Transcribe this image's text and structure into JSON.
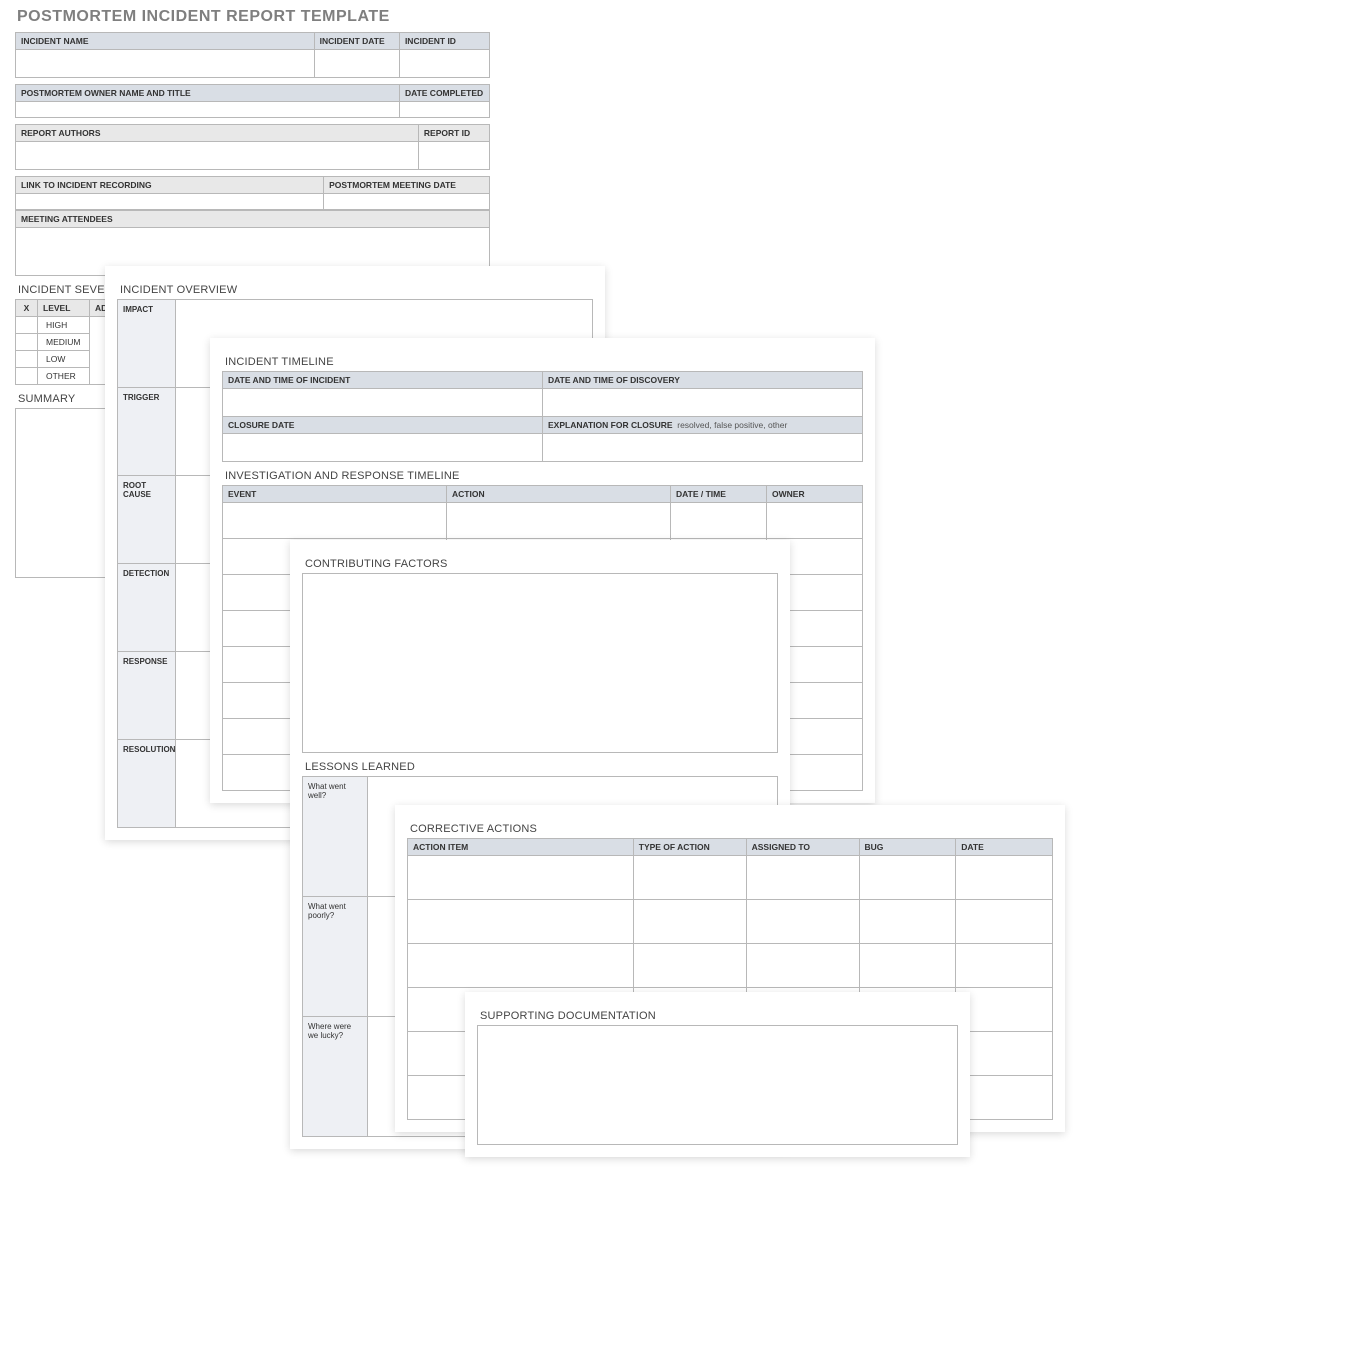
{
  "title": "POSTMORTEM INCIDENT REPORT TEMPLATE",
  "headers": {
    "incident_name": "INCIDENT NAME",
    "incident_date": "INCIDENT DATE",
    "incident_id": "INCIDENT ID",
    "owner": "POSTMORTEM OWNER NAME AND TITLE",
    "date_completed": "DATE COMPLETED",
    "report_authors": "REPORT AUTHORS",
    "report_id": "REPORT ID",
    "link_recording": "LINK TO INCIDENT RECORDING",
    "meeting_date": "POSTMORTEM MEETING DATE",
    "attendees": "MEETING ATTENDEES"
  },
  "severity": {
    "title": "INCIDENT SEVERITY",
    "x": "X",
    "level": "LEVEL",
    "add": "ADD",
    "levels": [
      "HIGH",
      "MEDIUM",
      "LOW",
      "OTHER"
    ]
  },
  "summary": "SUMMARY",
  "overview": {
    "title": "INCIDENT OVERVIEW",
    "rows": [
      "IMPACT",
      "TRIGGER",
      "ROOT CAUSE",
      "DETECTION",
      "RESPONSE",
      "RESOLUTION"
    ]
  },
  "timeline": {
    "title": "INCIDENT TIMELINE",
    "dt_incident": "DATE AND TIME OF INCIDENT",
    "dt_discovery": "DATE AND TIME OF DISCOVERY",
    "closure": "CLOSURE DATE",
    "closure_exp": "EXPLANATION FOR CLOSURE",
    "closure_hint": "resolved, false positive, other"
  },
  "investigation": {
    "title": "INVESTIGATION AND RESPONSE TIMELINE",
    "cols": [
      "EVENT",
      "ACTION",
      "DATE / TIME",
      "OWNER"
    ]
  },
  "contributing": "CONTRIBUTING FACTORS",
  "lessons": {
    "title": "LESSONS LEARNED",
    "rows": [
      "What went well?",
      "What went poorly?",
      "Where were we lucky?"
    ]
  },
  "corrective": {
    "title": "CORRECTIVE ACTIONS",
    "cols": [
      "ACTION ITEM",
      "TYPE OF ACTION",
      "ASSIGNED TO",
      "BUG",
      "DATE"
    ]
  },
  "supporting": "SUPPORTING DOCUMENTATION"
}
